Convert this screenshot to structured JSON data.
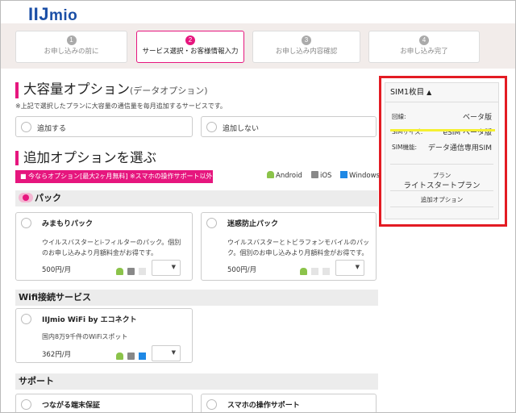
{
  "brand": {
    "logo_main": "IIJ",
    "logo_sub": "mio"
  },
  "steps": [
    {
      "num": "1",
      "label": "お申し込みの前に",
      "active": false
    },
    {
      "num": "2",
      "label": "サービス選択・お客様情報入力",
      "active": true
    },
    {
      "num": "3",
      "label": "お申し込み内容確認",
      "active": false
    },
    {
      "num": "4",
      "label": "お申し込み完了",
      "active": false
    }
  ],
  "capacity": {
    "title": "大容量オプション",
    "subtitle": "(データオプション)",
    "note": "※上記で選択したプランに大容量の通信量を毎月追加するサービスです。",
    "options": [
      "追加する",
      "追加しない"
    ]
  },
  "addon": {
    "title": "追加オプションを選ぶ",
    "promo": "今ならオプション[最大2ヶ月無料] ※スマホの操作サポート以外",
    "os_legend": [
      "Android",
      "iOS",
      "Windows"
    ]
  },
  "pack": {
    "header": "パック",
    "items": [
      {
        "name": "みまもりパック",
        "desc": "ウイルスバスターとi-フィルターのパック。個別のお申し込みより月額料金がお得です。",
        "price": "500円/月"
      },
      {
        "name": "迷惑防止パック",
        "desc": "ウイルスバスターとトビラフォンモバイルのパック。個別のお申し込みより月額料金がお得です。",
        "price": "500円/月"
      }
    ]
  },
  "wifi": {
    "header": "Wifi接続サービス",
    "items": [
      {
        "name": "IIJmio WiFi by エコネクト",
        "desc": "国内8万9千件のWiFiスポット",
        "price": "362円/月"
      }
    ]
  },
  "support": {
    "header": "サポート",
    "items": [
      {
        "name": "つながる端末保証"
      },
      {
        "name": "スマホの操作サポート"
      }
    ]
  },
  "summary": {
    "header": "SIM1枚目",
    "rows": [
      {
        "key": "回線:",
        "value": "ベータ版"
      },
      {
        "key": "SIMサイズ:",
        "value": "eSIM ベータ版"
      },
      {
        "key": "SIM機能:",
        "value": "データ通信専用SIM"
      }
    ],
    "plan_label": "プラン",
    "plan_name": "ライトスタートプラン",
    "option_label": "追加オプション"
  },
  "colors": {
    "brand": "#1b4fa6",
    "accent": "#e6167e",
    "callout": "#e31b23",
    "highlight": "#f5f032"
  },
  "select_arrow": "▼"
}
